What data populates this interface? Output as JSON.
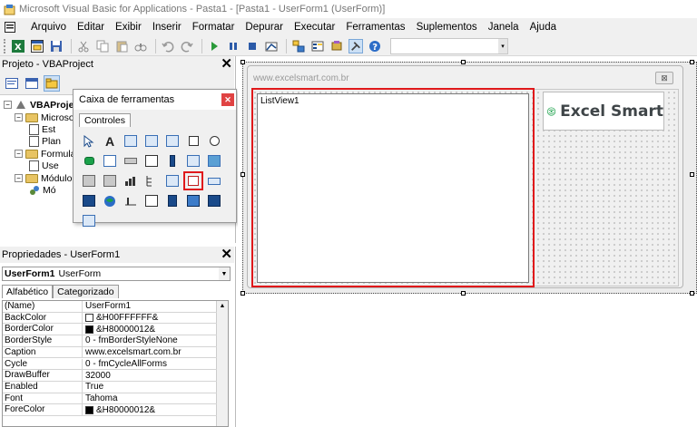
{
  "window": {
    "title": "Microsoft Visual Basic for Applications - Pasta1 - [Pasta1 - UserForm1 (UserForm)]"
  },
  "menu": {
    "items": [
      "Arquivo",
      "Editar",
      "Exibir",
      "Inserir",
      "Formatar",
      "Depurar",
      "Executar",
      "Ferramentas",
      "Suplementos",
      "Janela",
      "Ajuda"
    ]
  },
  "toolbar": {
    "icons": [
      "excel-icon",
      "insert-userform-icon",
      "save-icon",
      "cut-icon",
      "copy-icon",
      "paste-icon",
      "find-icon",
      "undo-icon",
      "redo-icon",
      "run-icon",
      "break-icon",
      "reset-icon",
      "design-mode-icon",
      "project-explorer-icon",
      "properties-window-icon",
      "object-browser-icon",
      "toolbox-icon",
      "help-icon"
    ]
  },
  "project": {
    "title": "Projeto - VBAProject",
    "tree": {
      "root": "VBAProje",
      "microsoft_folder": "Microso",
      "est": "Est",
      "plan": "Plan",
      "forms_folder": "Formula",
      "user": "Use",
      "modules_folder": "Módulo",
      "mod": "Mó"
    }
  },
  "toolbox": {
    "title": "Caixa de ferramentas",
    "tab": "Controles",
    "label_tool": "A"
  },
  "properties": {
    "title": "Propriedades - UserForm1",
    "object_name": "UserForm1",
    "object_type": "UserForm",
    "tabs": [
      "Alfabético",
      "Categorizado"
    ],
    "rows": [
      {
        "name": "(Name)",
        "value": "UserForm1",
        "swatch": ""
      },
      {
        "name": "BackColor",
        "value": "&H00FFFFFF&",
        "swatch": "#ffffff"
      },
      {
        "name": "BorderColor",
        "value": "&H80000012&",
        "swatch": "#000000"
      },
      {
        "name": "BorderStyle",
        "value": "0 - fmBorderStyleNone",
        "swatch": ""
      },
      {
        "name": "Caption",
        "value": "www.excelsmart.com.br",
        "swatch": ""
      },
      {
        "name": "Cycle",
        "value": "0 - fmCycleAllForms",
        "swatch": ""
      },
      {
        "name": "DrawBuffer",
        "value": "32000",
        "swatch": ""
      },
      {
        "name": "Enabled",
        "value": "True",
        "swatch": ""
      },
      {
        "name": "Font",
        "value": "Tahoma",
        "swatch": ""
      },
      {
        "name": "ForeColor",
        "value": "&H80000012&",
        "swatch": "#000000"
      }
    ]
  },
  "form": {
    "caption": "www.excelsmart.com.br",
    "close_glyph": "⊠",
    "listview_label": "ListView1",
    "logo_text": "Excel Smart",
    "logo_color": "#1aa14a"
  },
  "colors": {
    "highlight_red": "#e0191b"
  }
}
